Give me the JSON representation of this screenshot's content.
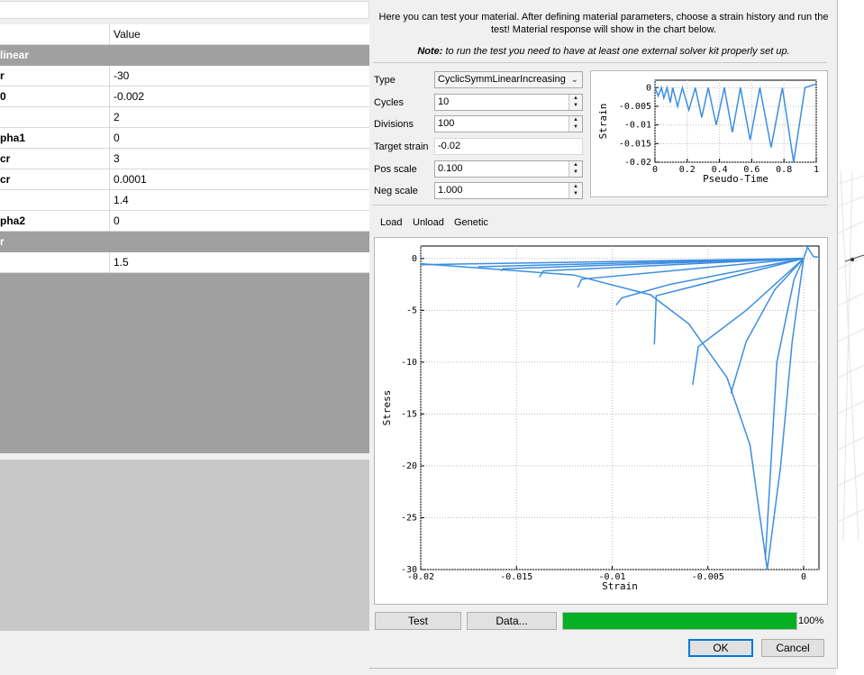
{
  "properties": {
    "header": {
      "name": "",
      "value": "Value"
    },
    "groups": [
      {
        "title": "linear",
        "rows": [
          {
            "name": "r",
            "value": "-30"
          },
          {
            "name": "0",
            "value": "-0.002"
          },
          {
            "name": "",
            "value": "2"
          },
          {
            "name": "pha1",
            "value": "0"
          },
          {
            "name": "cr",
            "value": "3"
          },
          {
            "name": "cr",
            "value": "0.0001"
          },
          {
            "name": "",
            "value": "1.4"
          },
          {
            "name": "pha2",
            "value": "0"
          }
        ]
      },
      {
        "title": "r",
        "rows": [
          {
            "name": "",
            "value": "1.5"
          }
        ]
      }
    ]
  },
  "dialog": {
    "intro": "Here you can test your material. After defining material parameters, choose a strain history and run the test! Material response will show in the chart below.",
    "note_bold": "Note:",
    "note_text": " to run the test you need to have at least one external solver kit properly set up.",
    "form": {
      "type_label": "Type",
      "type_value": "CyclicSymmLinearIncreasing",
      "cycles_label": "Cycles",
      "cycles_value": "10",
      "divisions_label": "Divisions",
      "divisions_value": "100",
      "target_label": "Target strain",
      "target_value": "-0.02",
      "pos_label": "Pos scale",
      "pos_value": "0.100",
      "neg_label": "Neg scale",
      "neg_value": "1.000"
    },
    "tabs": [
      "Load",
      "Unload",
      "Genetic"
    ],
    "buttons": {
      "test": "Test",
      "data": "Data...",
      "ok": "OK",
      "cancel": "Cancel"
    },
    "progress": {
      "value": 1.0,
      "label": "100%"
    },
    "colors": {
      "curve": "#3c8ee0",
      "progress": "#06b025",
      "group_bg": "#a0a0a0"
    }
  },
  "chart_data": [
    {
      "type": "line",
      "xlabel": "Pseudo-Time",
      "ylabel": "Strain",
      "xlim": [
        0,
        1
      ],
      "ylim": [
        -0.02,
        0.002
      ],
      "x_ticks": [
        "0",
        "0.2",
        "0.4",
        "0.6",
        "0.8",
        "1"
      ],
      "y_ticks": [
        "0",
        "-0.005",
        "-0.01",
        "-0.015",
        "-0.02"
      ],
      "grid": true,
      "series": [
        {
          "x": [
            0,
            0.02,
            0.04,
            0.055,
            0.075,
            0.095,
            0.11,
            0.14,
            0.17,
            0.21,
            0.25,
            0.29,
            0.33,
            0.38,
            0.43,
            0.48,
            0.53,
            0.59,
            0.65,
            0.72,
            0.79,
            0.86,
            0.93,
            1.0
          ],
          "y": [
            0,
            -0.0022,
            0,
            -0.0028,
            0,
            -0.004,
            0,
            -0.005,
            0,
            -0.006,
            0,
            -0.008,
            0,
            -0.01,
            0,
            -0.012,
            0,
            -0.014,
            0,
            -0.016,
            0,
            -0.02,
            0,
            0.001
          ]
        }
      ]
    },
    {
      "type": "line",
      "xlabel": "Strain",
      "ylabel": "Stress",
      "xlim": [
        -0.02,
        0.0008
      ],
      "ylim": [
        -30,
        1.2
      ],
      "x_ticks": [
        "-0.02",
        "-0.015",
        "-0.01",
        "-0.005",
        "0"
      ],
      "y_ticks": [
        "0",
        "-5",
        "-10",
        "-15",
        "-20",
        "-25",
        "-30"
      ],
      "grid": true,
      "series": [
        {
          "segments": [
            [
              [
                -0.02,
                -0.6
              ],
              [
                0,
                0
              ]
            ],
            [
              [
                -0.017,
                -0.8
              ],
              [
                -0.0002,
                0
              ]
            ],
            [
              [
                -0.0158,
                -1.2
              ],
              [
                -0.0157,
                -1.0
              ],
              [
                0,
                0
              ]
            ],
            [
              [
                -0.0138,
                -1.8
              ],
              [
                -0.0136,
                -1.2
              ],
              [
                0,
                0
              ]
            ],
            [
              [
                -0.0118,
                -2.8
              ],
              [
                -0.0116,
                -2.0
              ],
              [
                0,
                0
              ]
            ],
            [
              [
                -0.0098,
                -4.5
              ],
              [
                -0.0095,
                -3.8
              ],
              [
                -0.007,
                -2.5
              ],
              [
                0,
                0
              ]
            ],
            [
              [
                -0.0078,
                -8.3
              ],
              [
                -0.0077,
                -3.6
              ],
              [
                0,
                0
              ]
            ],
            [
              [
                -0.0058,
                -12.2
              ],
              [
                -0.0055,
                -8.5
              ],
              [
                -0.003,
                -5.0
              ],
              [
                0,
                0
              ]
            ],
            [
              [
                -0.0038,
                -13.0
              ],
              [
                -0.003,
                -8.0
              ],
              [
                -0.0015,
                -3.0
              ],
              [
                0,
                0
              ]
            ],
            [
              [
                -0.002,
                -29.0
              ],
              [
                -0.0014,
                -10.0
              ],
              [
                -0.0005,
                -2.0
              ],
              [
                0,
                0
              ]
            ],
            [
              [
                -0.02,
                -0.5
              ],
              [
                -0.012,
                -1.6
              ],
              [
                -0.008,
                -3.5
              ],
              [
                -0.006,
                -6.3
              ],
              [
                -0.004,
                -11.5
              ],
              [
                -0.0028,
                -18.0
              ],
              [
                -0.0019,
                -30.0
              ],
              [
                -0.0012,
                -20.0
              ],
              [
                -0.0006,
                -8.0
              ],
              [
                0,
                0
              ]
            ],
            [
              [
                0,
                0
              ],
              [
                0.0002,
                1.1
              ],
              [
                0.0005,
                0.2
              ],
              [
                0.0008,
                0.1
              ]
            ]
          ]
        }
      ]
    }
  ]
}
